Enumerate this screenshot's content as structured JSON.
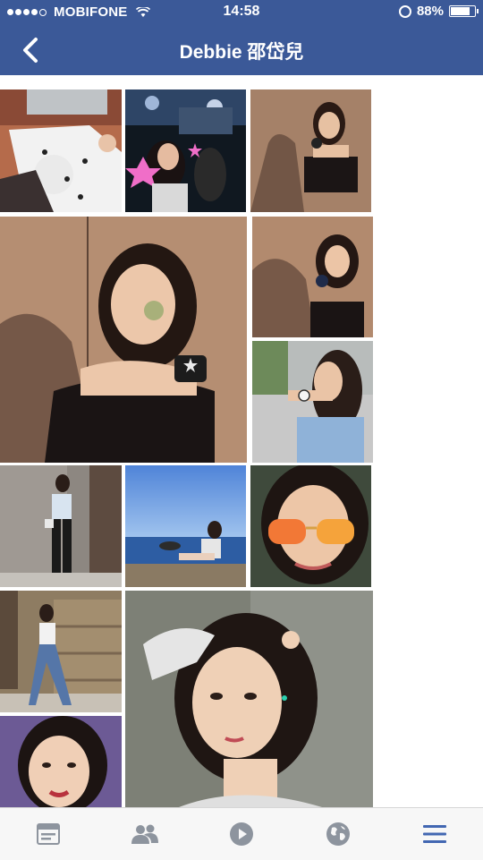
{
  "status_bar": {
    "carrier": "MOBIFONE",
    "time": "14:58",
    "battery": "88%",
    "battery_level": 0.88
  },
  "header": {
    "title": "Debbie 邵岱兒"
  },
  "colors": {
    "brand": "#3b5998",
    "tab_active": "#4267b2",
    "tab_inactive": "#8d949e"
  },
  "photos": [
    {
      "name": "photo-laptop-cat"
    },
    {
      "name": "photo-concert"
    },
    {
      "name": "photo-wall-cushion"
    },
    {
      "name": "photo-large-cushion-selfie"
    },
    {
      "name": "photo-wall-cushion-2"
    },
    {
      "name": "photo-blue-tee-watch"
    },
    {
      "name": "photo-street-outfit"
    },
    {
      "name": "photo-seaside"
    },
    {
      "name": "photo-sunglasses"
    },
    {
      "name": "photo-stairs-outfit"
    },
    {
      "name": "photo-large-portrait"
    },
    {
      "name": "photo-short-hair"
    }
  ],
  "tabs": [
    {
      "icon": "news-feed-icon",
      "active": false
    },
    {
      "icon": "friends-icon",
      "active": false
    },
    {
      "icon": "video-play-icon",
      "active": false
    },
    {
      "icon": "globe-icon",
      "active": false
    },
    {
      "icon": "menu-icon",
      "active": true
    }
  ]
}
